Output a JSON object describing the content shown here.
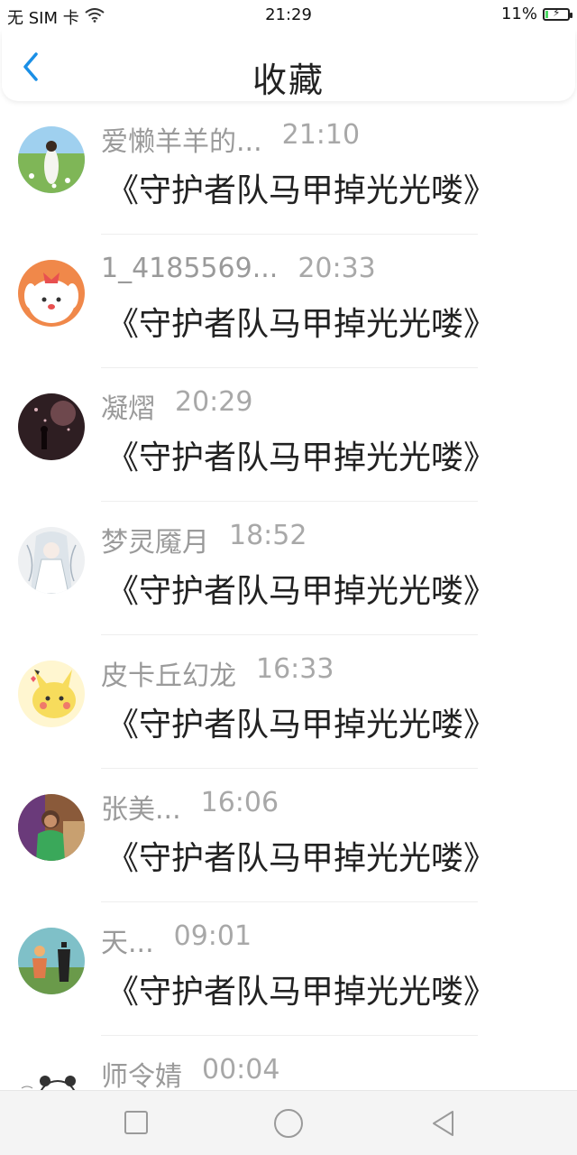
{
  "status_bar": {
    "carrier": "无 SIM 卡",
    "time": "21:29",
    "battery": "11%",
    "battery_level": 0.11
  },
  "header": {
    "title": "收藏"
  },
  "items": [
    {
      "user": "爱懒羊羊的...",
      "time": "21:10",
      "title": "《守护者队马甲掉光光喽》"
    },
    {
      "user": "1_4185569...",
      "time": "20:33",
      "title": "《守护者队马甲掉光光喽》"
    },
    {
      "user": "凝熠",
      "time": "20:29",
      "title": "《守护者队马甲掉光光喽》"
    },
    {
      "user": "梦灵魇月",
      "time": "18:52",
      "title": "《守护者队马甲掉光光喽》"
    },
    {
      "user": "皮卡丘幻龙",
      "time": "16:33",
      "title": "《守护者队马甲掉光光喽》"
    },
    {
      "user": "张美...",
      "time": "16:06",
      "title": "《守护者队马甲掉光光喽》"
    },
    {
      "user": "天...",
      "time": "09:01",
      "title": "《守护者队马甲掉光光喽》"
    },
    {
      "user": "师令婧",
      "time": "00:04",
      "title": ""
    }
  ],
  "colors": {
    "accent": "#1a8fe6",
    "text_primary": "#222222",
    "text_secondary": "#9a9a9a",
    "nav_bg": "#f4f4f4"
  }
}
